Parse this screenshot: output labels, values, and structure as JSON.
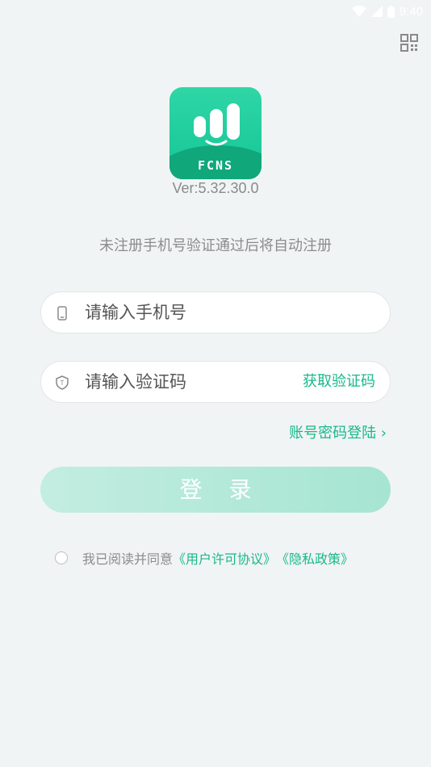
{
  "status_bar": {
    "time": "9:40"
  },
  "app": {
    "brand": "FCNS",
    "version": "Ver:5.32.30.0"
  },
  "hint": "未注册手机号验证通过后将自动注册",
  "phone_field": {
    "placeholder": "请输入手机号"
  },
  "code_field": {
    "placeholder": "请输入验证码",
    "get_code_label": "获取验证码"
  },
  "password_login_link": "账号密码登陆 ›",
  "login_button": "登 录",
  "agreement": {
    "prefix": "我已阅读并同意",
    "user_license": "《用户许可协议》",
    "privacy_policy": "《隐私政策》"
  },
  "colors": {
    "accent": "#17b98a",
    "logo": "#1ccf9c",
    "background": "#f1f4f4"
  }
}
